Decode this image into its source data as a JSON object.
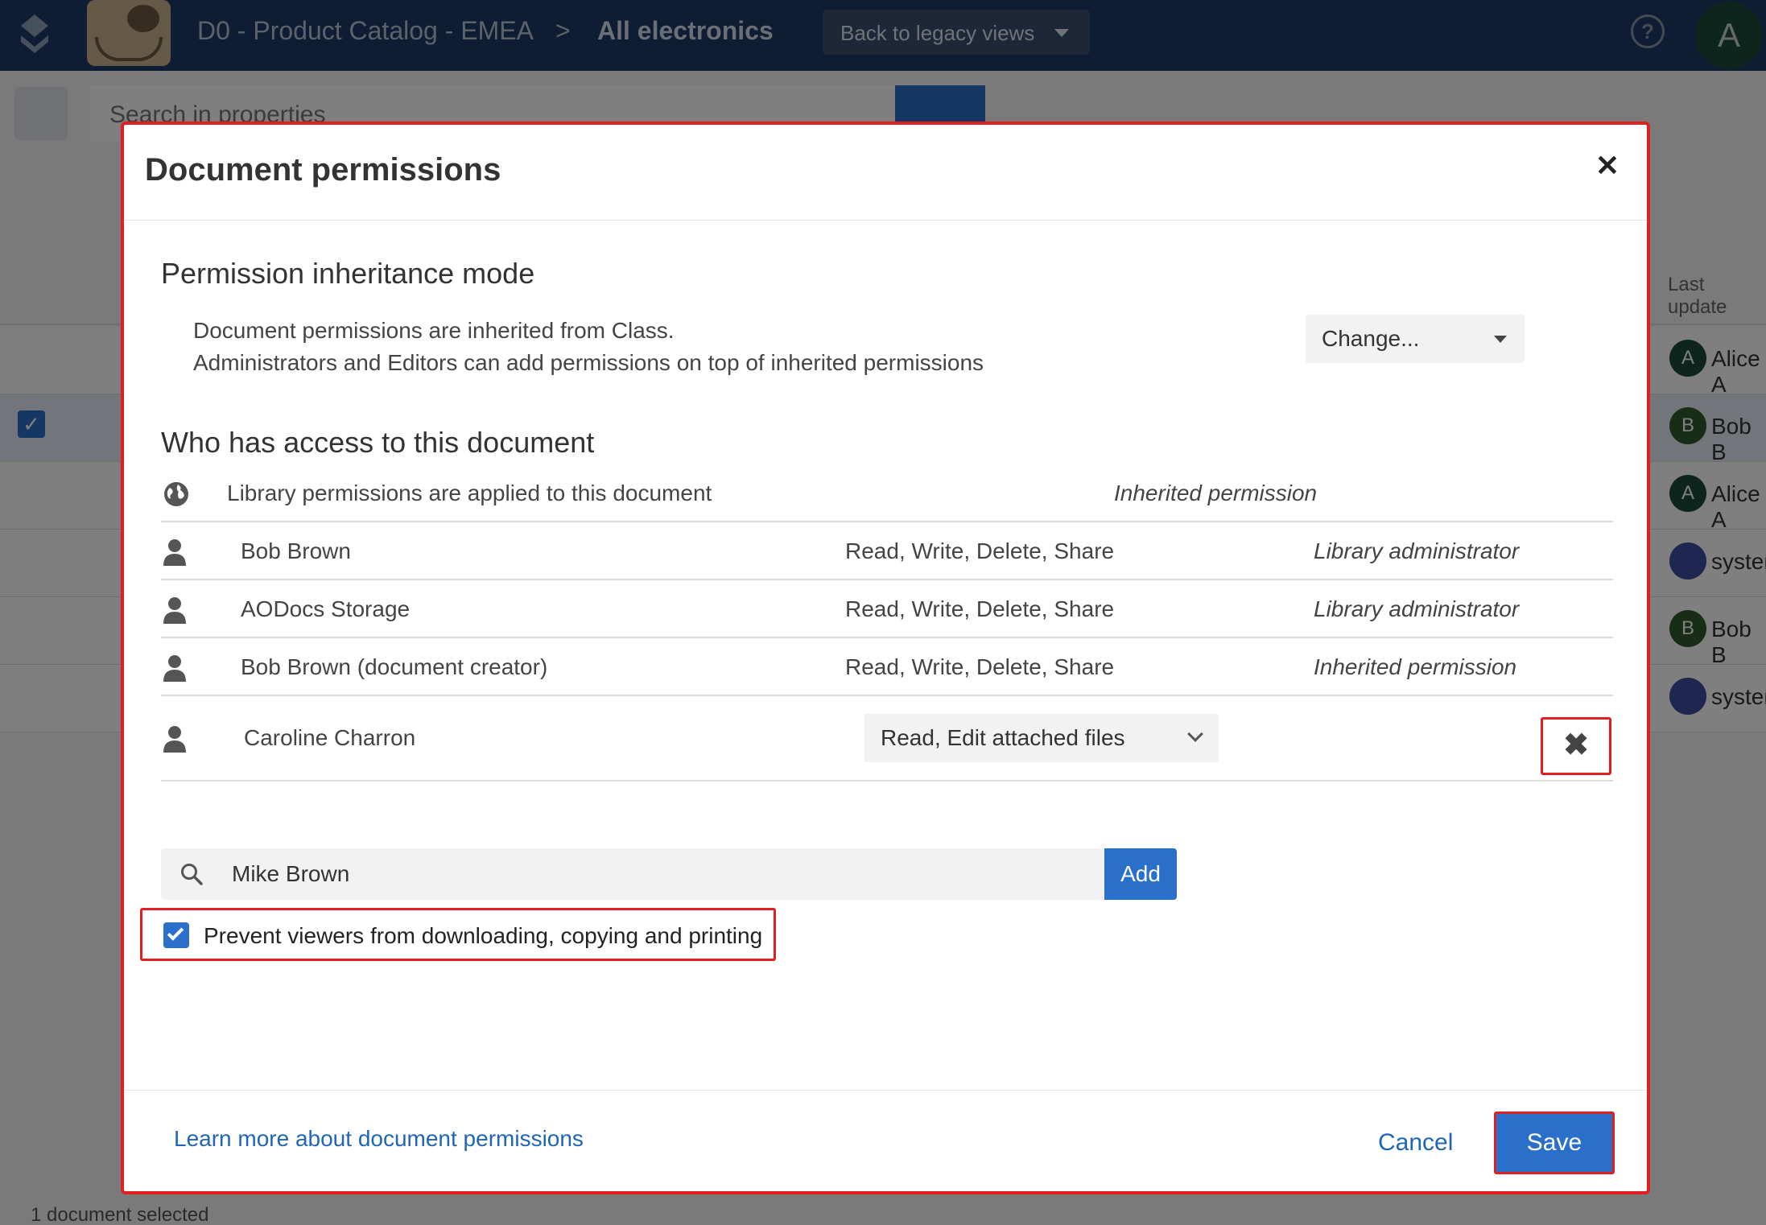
{
  "app": {
    "breadcrumb_library": "D0 - Product Catalog - EMEA",
    "breadcrumb_separator": ">",
    "breadcrumb_view": "All electronics",
    "legacy_button": "Back to legacy views",
    "help_icon": "question-circle-icon",
    "user_initial": "A",
    "search_placeholder": "Search in properties",
    "column_last_updated": "Last update",
    "footer_status": "1 document selected",
    "rows": [
      {
        "avatar": "A",
        "user": "Alice A",
        "color": "#1d4a3a"
      },
      {
        "avatar": "B",
        "user": "Bob B",
        "color": "#2e5a2a"
      },
      {
        "avatar": "A",
        "user": "Alice A",
        "color": "#1d4a3a"
      },
      {
        "avatar": "",
        "user": "system",
        "color": "#3b4f9e"
      },
      {
        "avatar": "B",
        "user": "Bob B",
        "color": "#2e5a2a"
      },
      {
        "avatar": "",
        "user": "system",
        "color": "#3b4f9e"
      }
    ]
  },
  "modal": {
    "title": "Document permissions",
    "close_icon": "close-icon",
    "inheritance": {
      "heading": "Permission inheritance mode",
      "line1": "Document permissions are inherited from Class.",
      "line2": "Administrators and Editors can add permissions on top of inherited permissions",
      "change_label": "Change..."
    },
    "access": {
      "heading": "Who has access to this document",
      "library_row": {
        "icon": "globe-icon",
        "name": "Library permissions are applied to this document",
        "origin": "Inherited permission"
      },
      "rows": [
        {
          "icon": "person-icon",
          "name": "Bob Brown",
          "rights": "Read, Write, Delete, Share",
          "origin": "Library administrator"
        },
        {
          "icon": "person-icon",
          "name": "AODocs Storage",
          "rights": "Read, Write, Delete, Share",
          "origin": "Library administrator"
        },
        {
          "icon": "person-icon",
          "name": "Bob Brown (document creator)",
          "rights": "Read, Write, Delete, Share",
          "origin": "Inherited permission"
        }
      ],
      "editable_row": {
        "icon": "person-icon",
        "name": "Caroline Charron",
        "rights_selected": "Read, Edit attached files",
        "remove_label": "✖"
      }
    },
    "add": {
      "search_icon": "search-icon",
      "value": "Mike Brown",
      "button": "Add"
    },
    "prevent": {
      "checked": true,
      "label": "Prevent viewers from downloading, copying and printing"
    },
    "footer": {
      "learn_more": "Learn more about document permissions",
      "cancel": "Cancel",
      "save": "Save"
    }
  }
}
